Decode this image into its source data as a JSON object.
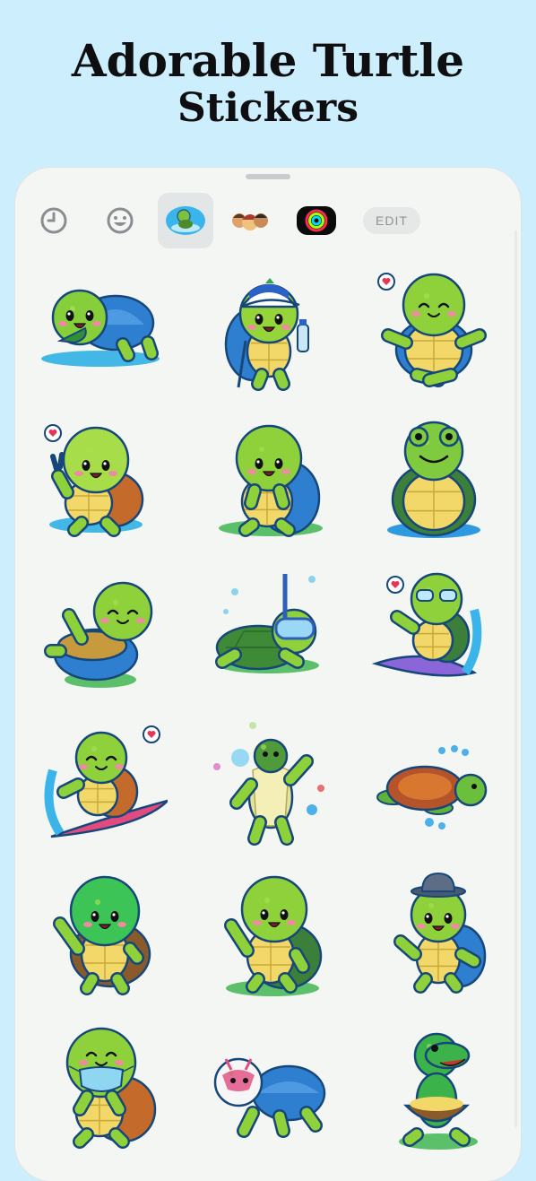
{
  "headline": {
    "line1": "Adorable Turtle",
    "line2": "Stickers"
  },
  "toolbar": {
    "items": [
      {
        "icon": "clock-icon",
        "label": "Recents"
      },
      {
        "icon": "smiley-icon",
        "label": "Emoji"
      },
      {
        "icon": "turtle-pack-icon",
        "label": "Turtle Stickers",
        "selected": true
      },
      {
        "icon": "avatar-pack-icon",
        "label": "Memoji Stickers"
      },
      {
        "icon": "activity-rings-icon",
        "label": "Activity"
      }
    ],
    "edit_label": "EDIT"
  },
  "stickers": [
    {
      "name": "turtle-eating-leaf-sticker",
      "pose": "eat"
    },
    {
      "name": "turtle-cap-water-bottle-sticker",
      "pose": "cap"
    },
    {
      "name": "turtle-meditating-sticker",
      "pose": "meditate"
    },
    {
      "name": "turtle-peace-sign-sticker",
      "pose": "peace"
    },
    {
      "name": "turtle-surprised-sticker",
      "pose": "surprised"
    },
    {
      "name": "frog-turtle-smiling-sticker",
      "pose": "frog"
    },
    {
      "name": "turtle-sleeping-in-shell-sticker",
      "pose": "sleep"
    },
    {
      "name": "turtle-snorkeling-sticker",
      "pose": "snorkel"
    },
    {
      "name": "turtle-surfing-sunglasses-sticker",
      "pose": "surf-glasses"
    },
    {
      "name": "turtle-surfing-sticker",
      "pose": "surf"
    },
    {
      "name": "sea-turtle-waving-bubbles-sticker",
      "pose": "sea-wave"
    },
    {
      "name": "sea-turtle-swimming-sticker",
      "pose": "swim"
    },
    {
      "name": "turtle-waving-sticker",
      "pose": "wave"
    },
    {
      "name": "turtle-waving-happy-sticker",
      "pose": "wave2"
    },
    {
      "name": "turtle-bowler-hat-sticker",
      "pose": "hat"
    },
    {
      "name": "turtle-face-mask-sticker",
      "pose": "mask"
    },
    {
      "name": "turtle-luchador-mask-sticker",
      "pose": "luchador"
    },
    {
      "name": "turtle-with-bowl-sticker",
      "pose": "bowl"
    }
  ]
}
